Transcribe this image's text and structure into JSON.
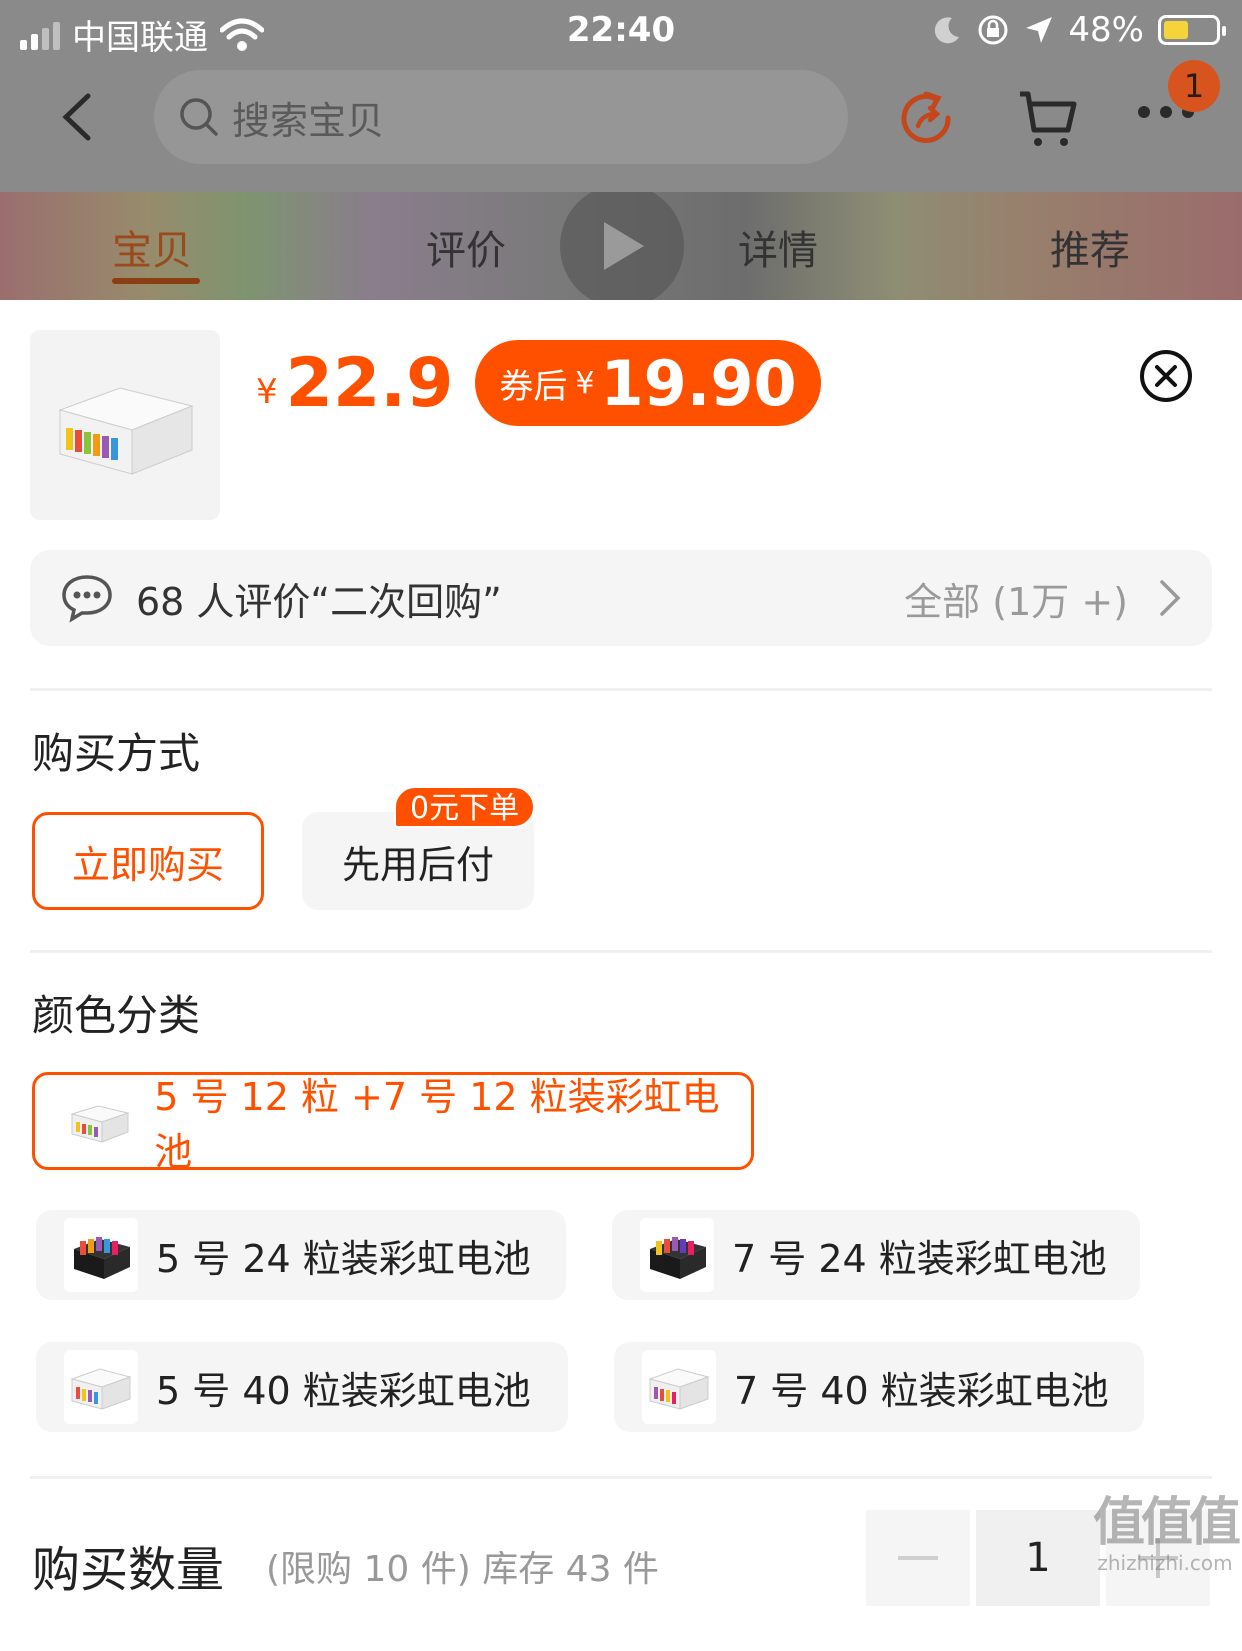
{
  "status_bar": {
    "carrier": "中国联通",
    "time": "22:40",
    "battery": "48%",
    "battery_level": 0.48
  },
  "nav": {
    "search_placeholder": "搜索宝贝",
    "badge_count": "1"
  },
  "tabs": [
    {
      "label": "宝贝",
      "active": true
    },
    {
      "label": "评价",
      "active": false
    },
    {
      "label": "详情",
      "active": false
    },
    {
      "label": "推荐",
      "active": false
    }
  ],
  "product": {
    "currency": "¥",
    "price": "22.9",
    "coupon_label": "券后",
    "coupon_currency": "¥",
    "coupon_price": "19.90"
  },
  "review": {
    "text": "68 人评价“二次回购”",
    "all": "全部 (1万 +)"
  },
  "purchase_method": {
    "title": "购买方式",
    "options": [
      "立即购买",
      "先用后付"
    ],
    "tag": "0元下单"
  },
  "color_category": {
    "title": "颜色分类",
    "options": [
      "5 号 12 粒 +7 号 12 粒装彩虹电池",
      "5 号 24 粒装彩虹电池",
      "7 号 24 粒装彩虹电池",
      "5 号 40 粒装彩虹电池",
      "7 号 40 粒装彩虹电池"
    ]
  },
  "quantity": {
    "label": "购买数量",
    "note": "(限购 10 件) 库存 43 件",
    "value": "1"
  },
  "watermark": {
    "big": "值值值",
    "small": "zhizhizhi.com"
  },
  "colors": {
    "accent": "#ff5000",
    "overlay": "#8a8a8a"
  }
}
